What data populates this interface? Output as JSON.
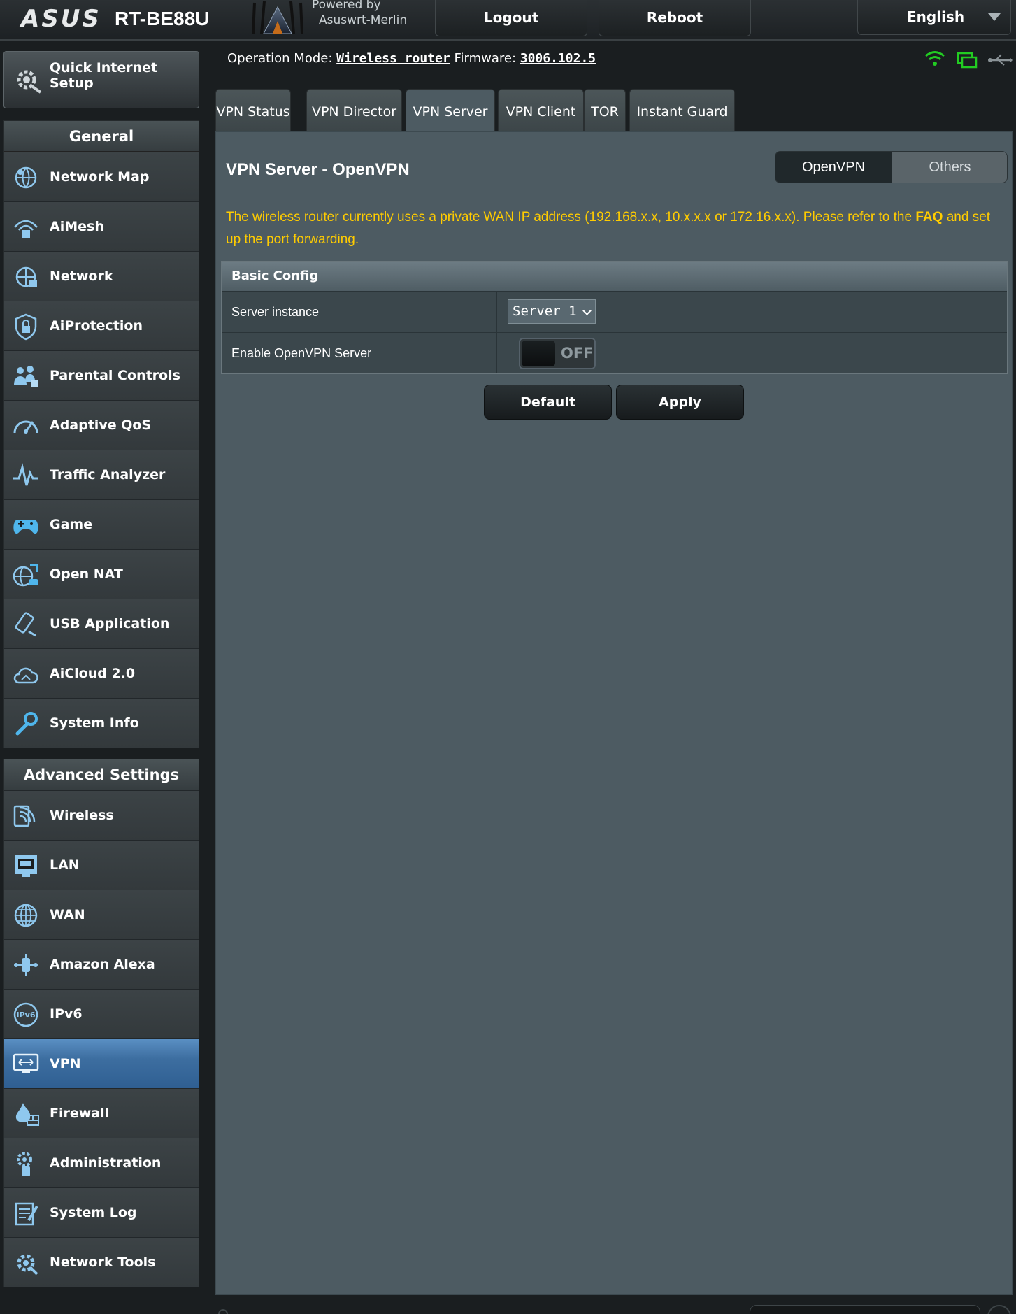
{
  "banner": {
    "brand": "ASUS",
    "model": "RT-BE88U",
    "powered_by_line1": "Powered by",
    "powered_by_line2": "Asuswrt-Merlin",
    "logout_label": "Logout",
    "reboot_label": "Reboot",
    "language": "English"
  },
  "status_bar": {
    "opmode_label": "Operation Mode:",
    "opmode_value": "Wireless router",
    "firmware_label": "Firmware:",
    "firmware_value": "3006.102.5",
    "icons": [
      "wifi-icon",
      "client-icon",
      "usb-icon"
    ],
    "icon_colors": {
      "wifi": "#22cc22",
      "client": "#22cc22",
      "usb": "#8a9296"
    }
  },
  "sidebar": {
    "qis_label_line1": "Quick Internet",
    "qis_label_line2": "Setup",
    "general_header": "General",
    "general_items": [
      {
        "label": "Network Map",
        "icon": "network-map-icon"
      },
      {
        "label": "AiMesh",
        "icon": "aimesh-icon"
      },
      {
        "label": "Network",
        "icon": "network-icon"
      },
      {
        "label": "AiProtection",
        "icon": "aiprotection-icon"
      },
      {
        "label": "Parental Controls",
        "icon": "parental-controls-icon"
      },
      {
        "label": "Adaptive QoS",
        "icon": "adaptive-qos-icon"
      },
      {
        "label": "Traffic Analyzer",
        "icon": "traffic-analyzer-icon"
      },
      {
        "label": "Game",
        "icon": "game-icon"
      },
      {
        "label": "Open NAT",
        "icon": "open-nat-icon"
      },
      {
        "label": "USB Application",
        "icon": "usb-application-icon"
      },
      {
        "label": "AiCloud 2.0",
        "icon": "aicloud-icon"
      },
      {
        "label": "System Info",
        "icon": "system-info-icon"
      }
    ],
    "advanced_header": "Advanced Settings",
    "advanced_items": [
      {
        "label": "Wireless",
        "icon": "wireless-icon"
      },
      {
        "label": "LAN",
        "icon": "lan-icon"
      },
      {
        "label": "WAN",
        "icon": "wan-icon"
      },
      {
        "label": "Amazon Alexa",
        "icon": "amazon-alexa-icon"
      },
      {
        "label": "IPv6",
        "icon": "ipv6-icon"
      },
      {
        "label": "VPN",
        "icon": "vpn-icon",
        "active": true
      },
      {
        "label": "Firewall",
        "icon": "firewall-icon"
      },
      {
        "label": "Administration",
        "icon": "administration-icon"
      },
      {
        "label": "System Log",
        "icon": "system-log-icon"
      },
      {
        "label": "Network Tools",
        "icon": "network-tools-icon"
      }
    ],
    "active_color": "#3d6ea0"
  },
  "tabs": [
    {
      "label": "VPN Status"
    },
    {
      "label": "VPN Director"
    },
    {
      "label": "VPN Server",
      "active": true
    },
    {
      "label": "VPN Client"
    },
    {
      "label": "TOR"
    },
    {
      "label": "Instant Guard"
    }
  ],
  "panel": {
    "title": "VPN Server - OpenVPN",
    "switch_openvpn": "OpenVPN",
    "switch_others": "Others",
    "notice_text": "The wireless router currently uses a private WAN IP address (192.168.x.x, 10.x.x.x or 172.16.x.x). Please refer to the",
    "notice_link": "FAQ",
    "notice_tail": "and set up the port forwarding.",
    "notice_color": "#ffcc00",
    "basic_config": {
      "header": "Basic Config",
      "server_instance_label": "Server instance",
      "server_instance_value": "Server 1",
      "enable_label": "Enable OpenVPN Server",
      "enable_state": "OFF"
    },
    "default_label": "Default",
    "apply_label": "Apply"
  }
}
